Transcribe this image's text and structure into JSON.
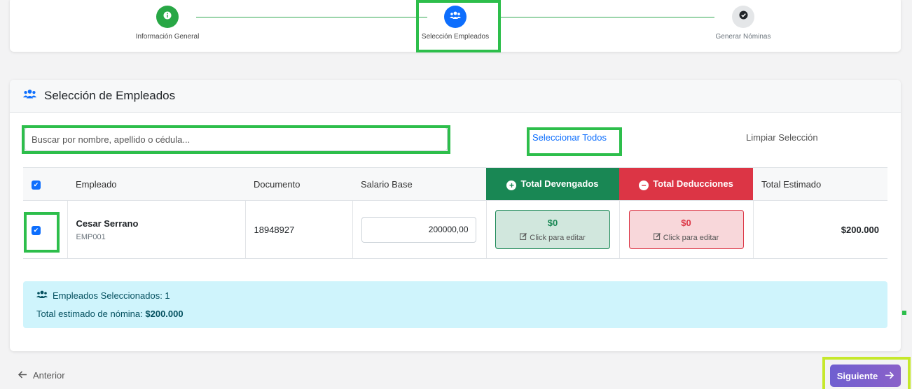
{
  "stepper": {
    "steps": [
      {
        "label": "Información General",
        "state": "done",
        "icon": "info-icon"
      },
      {
        "label": "Selección Empleados",
        "state": "active",
        "icon": "users-icon"
      },
      {
        "label": "Generar Nóminas",
        "state": "pending",
        "icon": "check-circle-icon"
      }
    ]
  },
  "card": {
    "title": "Selección de Empleados",
    "icon": "users-icon"
  },
  "search": {
    "placeholder": "Buscar por nombre, apellido o cédula..."
  },
  "actions": {
    "select_all": "Seleccionar Todos",
    "clear_selection": "Limpiar Selección"
  },
  "table": {
    "headers": {
      "employee": "Empleado",
      "document": "Documento",
      "base_salary": "Salario Base",
      "total_earnings": "Total Devengados",
      "total_deductions": "Total Deducciones",
      "total_estimated": "Total Estimado"
    },
    "rows": [
      {
        "selected": true,
        "name": "Cesar Serrano",
        "code": "EMP001",
        "document": "18948927",
        "base_salary": "200000,00",
        "earnings": "$0",
        "earnings_hint": "Click para editar",
        "deductions": "$0",
        "deductions_hint": "Click para editar",
        "total": "$200.000"
      }
    ]
  },
  "summary": {
    "title": "Empleados Seleccionados: 1",
    "total_label": "Total estimado de nómina:",
    "total_value": "$200.000"
  },
  "footer": {
    "previous": "Anterior",
    "next": "Siguiente"
  },
  "colors": {
    "primary": "#0d6efd",
    "success": "#198754",
    "danger": "#dc3545",
    "info_bg": "#cff4fc",
    "next_button": "#7160cc",
    "highlight": "#2dbe4b"
  }
}
